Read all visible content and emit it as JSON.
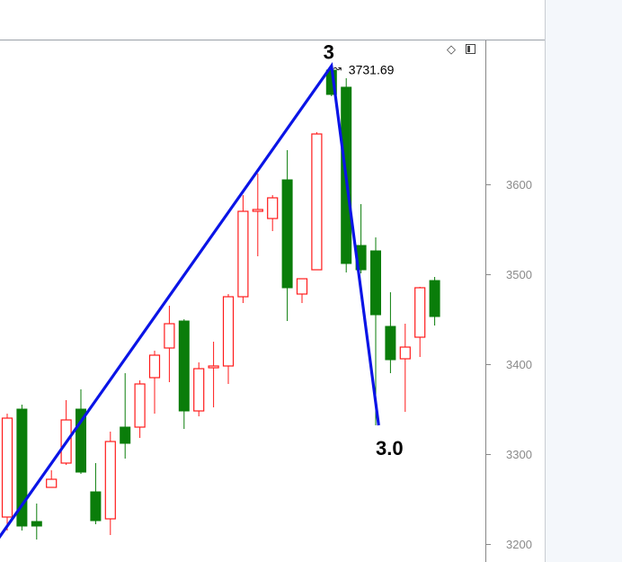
{
  "chart_data": {
    "type": "candlestick",
    "y_axis": {
      "ticks": [
        3600,
        3500,
        3400,
        3300,
        3200
      ],
      "tick_labels": [
        "3600",
        "3500",
        "3400",
        "3300",
        "3200"
      ],
      "position": "right"
    },
    "candles": [
      {
        "open": 3230,
        "high": 3345,
        "low": 3215,
        "close": 3340
      },
      {
        "open": 3350,
        "high": 3355,
        "low": 3215,
        "close": 3220
      },
      {
        "open": 3225,
        "high": 3245,
        "low": 3205,
        "close": 3220
      },
      {
        "open": 3263,
        "high": 3282,
        "low": 3263,
        "close": 3272
      },
      {
        "open": 3290,
        "high": 3360,
        "low": 3288,
        "close": 3338
      },
      {
        "open": 3350,
        "high": 3372,
        "low": 3278,
        "close": 3280
      },
      {
        "open": 3258,
        "high": 3290,
        "low": 3222,
        "close": 3226
      },
      {
        "open": 3228,
        "high": 3325,
        "low": 3210,
        "close": 3314
      },
      {
        "open": 3330,
        "high": 3390,
        "low": 3295,
        "close": 3312
      },
      {
        "open": 3330,
        "high": 3382,
        "low": 3318,
        "close": 3378
      },
      {
        "open": 3385,
        "high": 3415,
        "low": 3345,
        "close": 3410
      },
      {
        "open": 3418,
        "high": 3465,
        "low": 3380,
        "close": 3445
      },
      {
        "open": 3448,
        "high": 3450,
        "low": 3328,
        "close": 3348
      },
      {
        "open": 3348,
        "high": 3402,
        "low": 3342,
        "close": 3395
      },
      {
        "open": 3396,
        "high": 3425,
        "low": 3352,
        "close": 3398
      },
      {
        "open": 3398,
        "high": 3478,
        "low": 3378,
        "close": 3475
      },
      {
        "open": 3475,
        "high": 3588,
        "low": 3468,
        "close": 3570
      },
      {
        "open": 3570,
        "high": 3612,
        "low": 3520,
        "close": 3572
      },
      {
        "open": 3562,
        "high": 3588,
        "low": 3548,
        "close": 3585
      },
      {
        "open": 3605,
        "high": 3638,
        "low": 3448,
        "close": 3485
      },
      {
        "open": 3478,
        "high": 3495,
        "low": 3468,
        "close": 3495
      },
      {
        "open": 3505,
        "high": 3658,
        "low": 3505,
        "close": 3656
      },
      {
        "open": 3727,
        "high": 3731.69,
        "low": 3698,
        "close": 3700
      },
      {
        "open": 3708,
        "high": 3718,
        "low": 3502,
        "close": 3512
      },
      {
        "open": 3532,
        "high": 3578,
        "low": 3501,
        "close": 3505
      },
      {
        "open": 3526,
        "high": 3541,
        "low": 3332,
        "close": 3455
      },
      {
        "open": 3442,
        "high": 3480,
        "low": 3390,
        "close": 3405
      },
      {
        "open": 3406,
        "high": 3445,
        "low": 3347,
        "close": 3419
      },
      {
        "open": 3430,
        "high": 3486,
        "low": 3408,
        "close": 3485
      },
      {
        "open": 3493,
        "high": 3497,
        "low": 3443,
        "close": 3453
      }
    ],
    "colors": {
      "up": "#ff1a1a",
      "down": "#0a7d0a",
      "trendline": "#0a14e6",
      "axis": "#888888",
      "text": "#000000"
    },
    "trendline_points": [
      {
        "candle": -0.9,
        "value": 3199
      },
      {
        "candle": 22,
        "value": 3731.69
      },
      {
        "candle": 25.2,
        "value": 3332
      }
    ],
    "annotations": {
      "wave_top_label": "3",
      "wave_bottom_label": "3.0",
      "high_marker": "↝",
      "high_value_label": "3731.69"
    }
  },
  "ui": {
    "diamond_icon": "diamond-outline-icon",
    "panel_icon": "panel-toggle-icon"
  }
}
